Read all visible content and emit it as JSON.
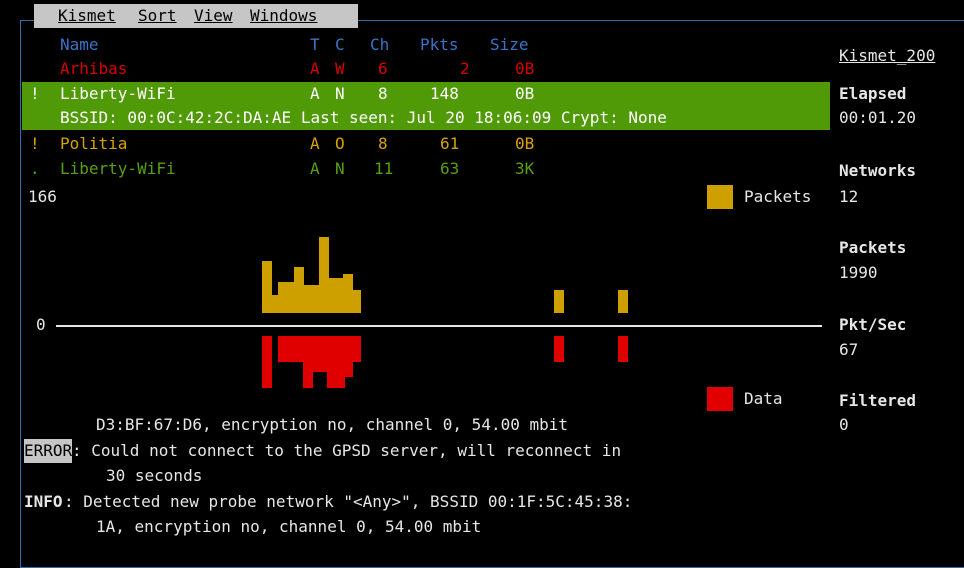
{
  "menu": [
    "Kismet",
    "Sort",
    "View",
    "Windows"
  ],
  "columns": {
    "name": "Name",
    "t": "T",
    "c": "C",
    "ch": "Ch",
    "pkts": "Pkts",
    "size": "Size"
  },
  "networks": [
    {
      "flag": "",
      "name": "Arhibas",
      "t": "A",
      "c": "W",
      "ch": "6",
      "pkts": "2",
      "size": "0B"
    },
    {
      "flag": "!",
      "name": "Liberty-WiFi",
      "t": "A",
      "c": "N",
      "ch": "8",
      "pkts": "148",
      "size": "0B"
    },
    {
      "flag": "!",
      "name": "Politia",
      "t": "A",
      "c": "O",
      "ch": "8",
      "pkts": "61",
      "size": "0B"
    },
    {
      "flag": ".",
      "name": "Liberty-WiFi",
      "t": "A",
      "c": "N",
      "ch": "11",
      "pkts": "63",
      "size": "3K"
    }
  ],
  "selected_detail": "BSSID: 00:0C:42:2C:DA:AE Last seen: Jul 20 18:06:09 Crypt: None",
  "graph": {
    "max_label": "166",
    "zero_label": "0",
    "legend_packets": "Packets",
    "legend_data": "Data",
    "colors": {
      "packets": "#cda000",
      "data": "#e00000"
    },
    "packets": [
      0,
      0,
      0,
      0,
      0,
      0,
      0,
      0,
      0,
      0,
      0,
      0,
      0,
      0,
      0,
      0,
      0,
      0,
      0,
      0,
      0,
      0,
      0.45,
      0.16,
      0.27,
      0.27,
      0.4,
      0.24,
      0.24,
      0.66,
      0.3,
      0.3,
      0.34,
      0.2,
      0,
      0,
      0,
      0,
      0,
      0,
      0,
      0,
      0,
      0,
      0,
      0,
      0,
      0,
      0,
      0,
      0,
      0,
      0,
      0,
      0,
      0,
      0,
      0,
      0.2,
      0,
      0,
      0,
      0,
      0,
      0,
      0,
      0.2
    ],
    "data": [
      0,
      0,
      0,
      0,
      0,
      0,
      0,
      0,
      0,
      0,
      0,
      0,
      0,
      0,
      0,
      0,
      0,
      0,
      0,
      0,
      0,
      0,
      0.45,
      0,
      0.23,
      0.23,
      0.23,
      0.45,
      0.31,
      0.31,
      0.45,
      0.45,
      0.36,
      0.23,
      0,
      0,
      0,
      0,
      0,
      0,
      0,
      0,
      0,
      0,
      0,
      0,
      0,
      0,
      0,
      0,
      0,
      0,
      0,
      0,
      0,
      0,
      0,
      0,
      0.23,
      0,
      0,
      0,
      0,
      0,
      0,
      0,
      0.23
    ]
  },
  "log": [
    {
      "label": "",
      "text": "D3:BF:67:D6, encryption no, channel 0, 54.00 mbit"
    },
    {
      "label": "ERROR",
      "text": ": Could not connect to the GPSD server, will reconnect in"
    },
    {
      "label": "",
      "text": "30 seconds"
    },
    {
      "label": "INFO",
      "text": ": Detected new probe network \"<Any>\", BSSID 00:1F:5C:45:38:"
    },
    {
      "label": "",
      "text": "1A, encryption no, channel 0, 54.00 mbit"
    }
  ],
  "sidebar": {
    "title": "Kismet_200",
    "elapsed_label": "Elapsed",
    "elapsed_value": "00:01.20",
    "networks_label": "Networks",
    "networks_value": "12",
    "packets_label": "Packets",
    "packets_value": "1990",
    "pktsec_label": "Pkt/Sec",
    "pktsec_value": "67",
    "filtered_label": "Filtered",
    "filtered_value": "0"
  }
}
